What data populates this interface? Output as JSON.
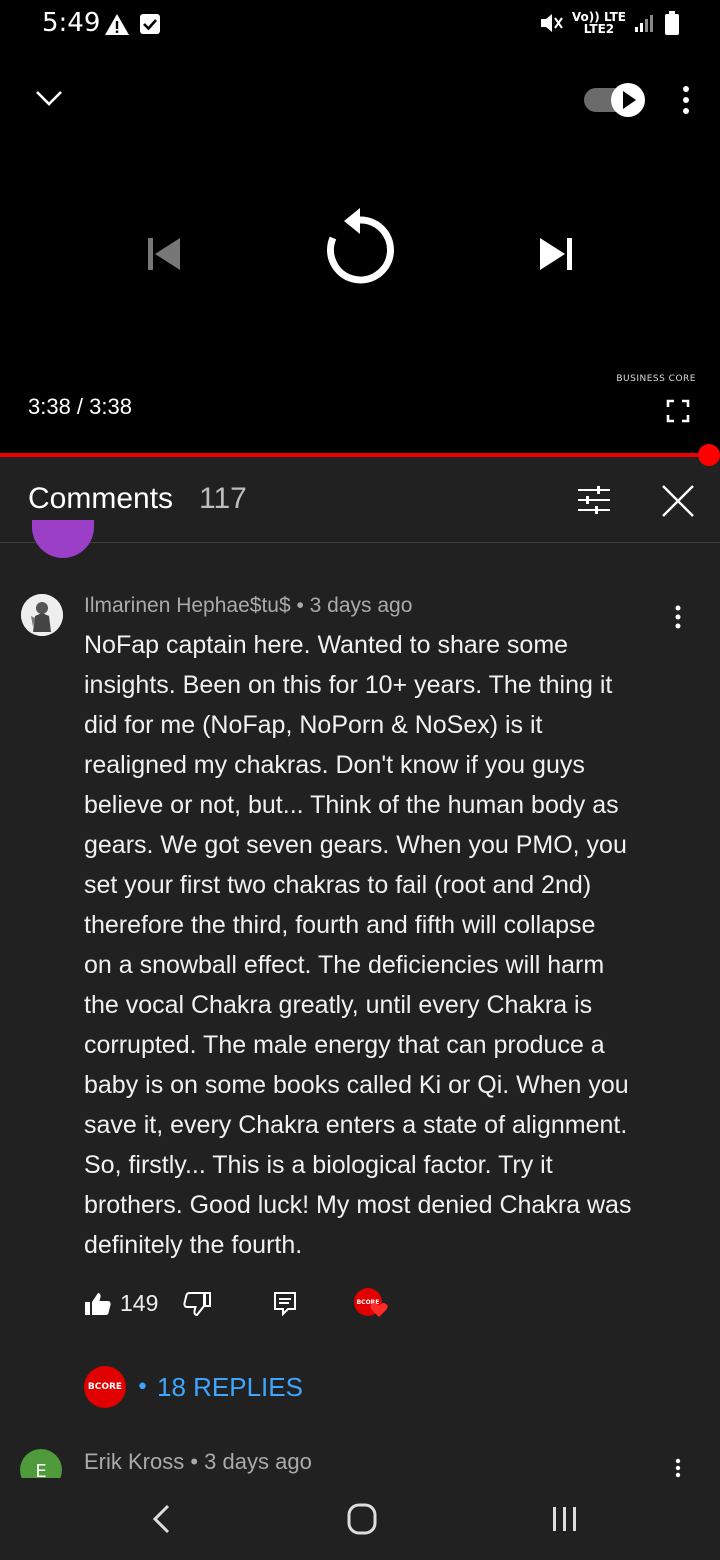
{
  "status_bar": {
    "time": "5:49",
    "network_line1": "Vo)) LTE",
    "network_line2": "LTE2"
  },
  "player": {
    "watermark": "BUSINESS CORE",
    "time_readout": "3:38 / 3:38",
    "progress_percent": 100,
    "accent_color": "#ff0000"
  },
  "comments_panel": {
    "title": "Comments",
    "count": "117"
  },
  "comment": {
    "author_meta": "Ilmarinen Hephae$tu$ • 3 days ago",
    "text": "NoFap captain here. Wanted to share some\ninsights. Been on this for 10+ years. The thing it\ndid for me (NoFap, NoPorn & NoSex) is it\nrealigned my chakras. Don't know if you guys\nbelieve or not, but... Think of the human body as\ngears. We got seven gears. When you PMO, you\nset your first two chakras to fail (root and 2nd)\ntherefore the third, fourth and fifth will collapse\non a snowball effect. The deficiencies will harm\nthe vocal Chakra greatly, until every Chakra is\ncorrupted. The male energy that can produce a\nbaby is on some books called Ki or Qi. When you\nsave it, every Chakra enters a state of alignment.\nSo, firstly... This is a biological factor. Try it\nbrothers. Good luck! My most denied Chakra was\ndefinitely the fourth.",
    "like_count": "149",
    "creator_badge": "BCORE",
    "replies_label": "18 REPLIES",
    "reply_color": "#3ea6ff"
  },
  "next_comment": {
    "avatar_letter": "E",
    "author_meta": "Erik Kross • 3 days ago"
  }
}
